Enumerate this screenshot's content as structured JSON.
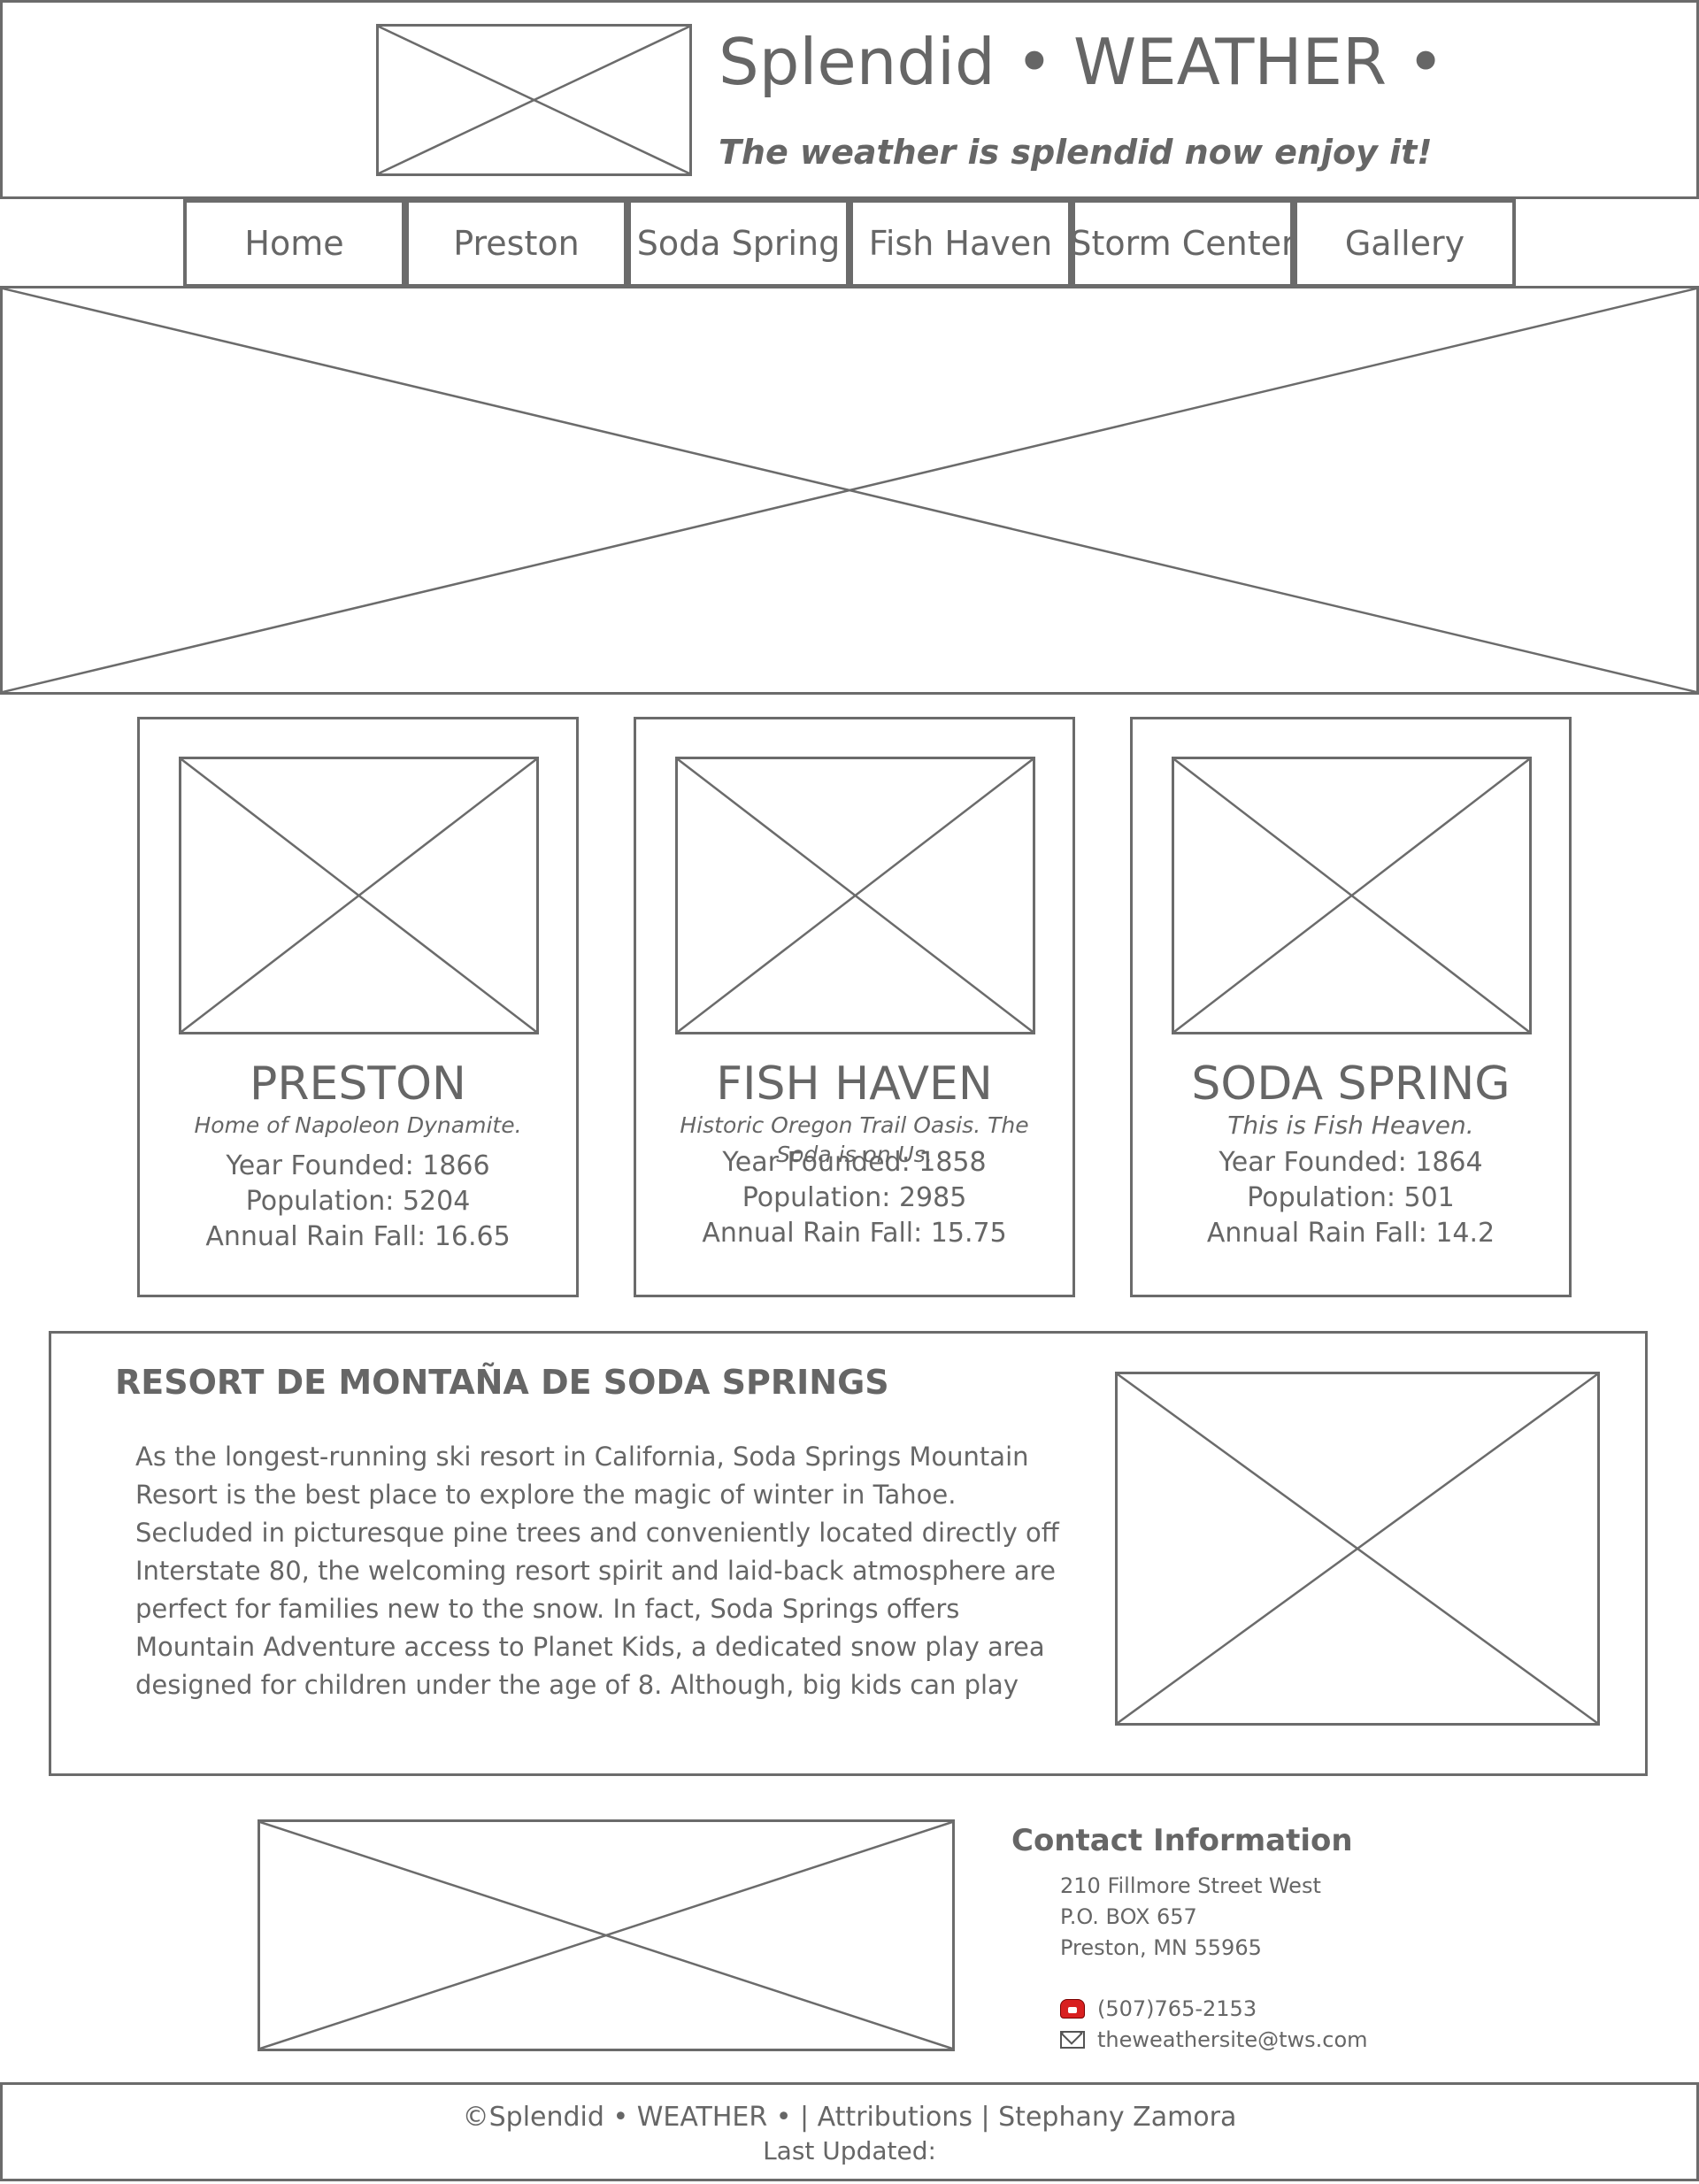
{
  "header": {
    "site_title": "Splendid • WEATHER •",
    "tagline": "The weather is splendid now enjoy it!"
  },
  "nav": {
    "items": [
      {
        "label": "Home"
      },
      {
        "label": "Preston"
      },
      {
        "label": "Soda Spring"
      },
      {
        "label": "Fish Haven"
      },
      {
        "label": "Storm Center"
      },
      {
        "label": "Gallery"
      }
    ]
  },
  "towns": [
    {
      "name": "PRESTON",
      "motto": "Home of Napoleon Dynamite.",
      "year_founded": "Year Founded: 1866",
      "population": "Population: 5204",
      "rainfall": "Annual Rain Fall: 16.65"
    },
    {
      "name": "FISH HAVEN",
      "motto": "Historic Oregon Trail Oasis. The Soda is on Us.",
      "year_founded": "Year Founded: 1858",
      "population": "Population: 2985",
      "rainfall": "Annual Rain Fall: 15.75"
    },
    {
      "name": "SODA SPRING",
      "motto": "This is Fish Heaven.",
      "year_founded": "Year Founded: 1864",
      "population": "Population: 501",
      "rainfall": "Annual Rain Fall: 14.2"
    }
  ],
  "resort": {
    "title": "RESORT DE MONTAÑA DE SODA SPRINGS",
    "text": "As the longest-running ski resort in California, Soda Springs Mountain Resort is the best place to explore the magic of winter in Tahoe. Secluded in picturesque pine trees and conveniently located directly off Interstate 80, the welcoming resort spirit and laid-back atmosphere are perfect for families new to the snow. In fact, Soda Springs offers Mountain Adventure access to Planet Kids, a dedicated snow play area designed for children under the age of 8. Although, big kids can play too! Planet Kids is best described as a snow playground with"
  },
  "contact": {
    "title": "Contact Information",
    "address_line1": "210 Fillmore Street West",
    "address_line2": "P.O. BOX 657",
    "address_line3": "Preston, MN 55965",
    "phone": "(507)765-2153",
    "email": "theweathersite@tws.com",
    "phone_icon": "telephone-icon",
    "email_icon": "envelope-icon"
  },
  "footer": {
    "line1": "©Splendid • WEATHER • | Attributions | Stephany Zamora",
    "line2": "Last Updated:"
  }
}
